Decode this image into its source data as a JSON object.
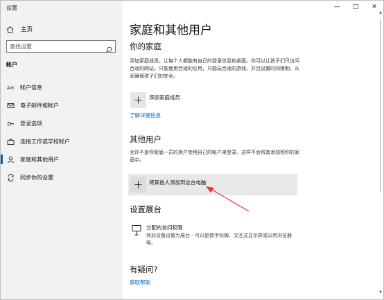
{
  "window": {
    "title": "设置",
    "controls": {
      "minimize": "—",
      "maximize": "□",
      "close": "✕"
    }
  },
  "sidebar": {
    "home_label": "主页",
    "search_placeholder": "查找设置",
    "section_heading": "帐户",
    "items": [
      {
        "label": "帐户信息",
        "icon": "account-info-icon",
        "active": false
      },
      {
        "label": "电子邮件和帐户",
        "icon": "mail-icon",
        "active": false
      },
      {
        "label": "登录选项",
        "icon": "key-icon",
        "active": false
      },
      {
        "label": "连接工作或学校帐户",
        "icon": "briefcase-icon",
        "active": false
      },
      {
        "label": "家庭和其他用户",
        "icon": "person-icon",
        "active": true
      },
      {
        "label": "同步你的设置",
        "icon": "sync-icon",
        "active": false
      }
    ]
  },
  "main": {
    "title": "家庭和其他用户",
    "family": {
      "heading": "你的家庭",
      "description": "添加家庭成员，让每个人都能有自己的登录信息和桌面。你可以让孩子们只访问合适的网站，只能使用合适的应用，只能玩合适的游戏，并且设置时间限制，从而确保孩子们的安全。",
      "add_label": "添加家庭成员",
      "learn_more": "了解详细信息"
    },
    "other_users": {
      "heading": "其他用户",
      "description": "允许不是你家庭一员的用户使用自己的帐户来登录。这样不会将其添加到你的家庭中。",
      "add_label": "将其他人添加到这台电脑"
    },
    "kiosk": {
      "heading": "设置展台",
      "title": "分配的访问权限",
      "description": "将此设备设置为展台 - 可以是数字标牌、交互式显示屏或公用浏览器等。"
    },
    "help": {
      "heading": "有疑问?",
      "link": "获取帮助"
    }
  },
  "colors": {
    "accent": "#0063b1",
    "sidebar_bg": "#f2f2f2",
    "arrow": "#e53935"
  }
}
